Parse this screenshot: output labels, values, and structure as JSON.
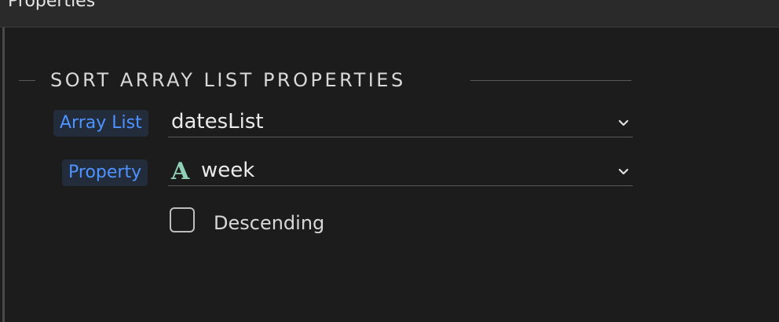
{
  "panel": {
    "title": "Properties"
  },
  "section": {
    "title": "SORT ARRAY LIST PROPERTIES"
  },
  "fields": {
    "array_list": {
      "label": "Array List",
      "value": "datesList",
      "icon": "chevron-down-icon"
    },
    "property": {
      "label": "Property",
      "value": "week",
      "type_icon": "A",
      "type_icon_name": "string-type-icon",
      "icon": "chevron-down-icon"
    }
  },
  "descending": {
    "label": "Descending",
    "checked": false
  },
  "colors": {
    "background": "#1c1c1c",
    "label_accent": "#4f93ff",
    "type_icon": "#8fd0b6"
  }
}
